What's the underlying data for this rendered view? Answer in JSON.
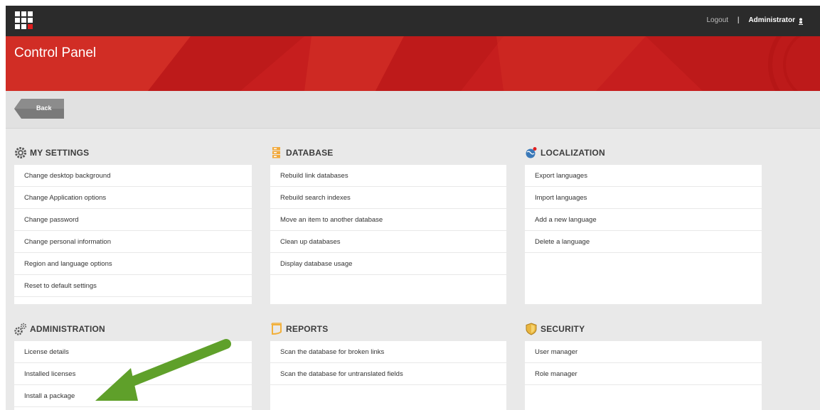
{
  "header": {
    "logout": "Logout",
    "separator": "|",
    "user": "Administrator"
  },
  "banner": {
    "title": "Control Panel"
  },
  "toolbar": {
    "back": "Back"
  },
  "sections": {
    "my_settings": {
      "title": "MY SETTINGS",
      "items": [
        "Change desktop background",
        "Change Application options",
        "Change password",
        "Change personal information",
        "Region and language options",
        "Reset to default settings"
      ]
    },
    "database": {
      "title": "DATABASE",
      "items": [
        "Rebuild link databases",
        "Rebuild search indexes",
        "Move an item to another database",
        "Clean up databases",
        "Display database usage"
      ]
    },
    "localization": {
      "title": "LOCALIZATION",
      "items": [
        "Export languages",
        "Import languages",
        "Add a new language",
        "Delete a language"
      ]
    },
    "administration": {
      "title": "ADMINISTRATION",
      "items": [
        "License details",
        "Installed licenses",
        "Install a package"
      ]
    },
    "reports": {
      "title": "REPORTS",
      "items": [
        "Scan the database for broken links",
        "Scan the database for untranslated fields"
      ]
    },
    "security": {
      "title": "SECURITY",
      "items": [
        "User manager",
        "Role manager"
      ]
    }
  },
  "colors": {
    "banner_red": "#c61e1e",
    "topbar": "#2b2b2b",
    "arrow_green": "#5fa02a",
    "database_icon": "#f2a93b",
    "reports_icon": "#f2b03c",
    "security_icon": "#e9b640"
  },
  "icons": {
    "logo": "grid-logo-icon",
    "user": "user-icon",
    "my_settings": "gear-icon",
    "database": "database-icon",
    "localization": "globe-icon",
    "administration": "gears-icon",
    "reports": "report-icon",
    "security": "shield-icon",
    "annotation": "green-arrow-icon"
  }
}
